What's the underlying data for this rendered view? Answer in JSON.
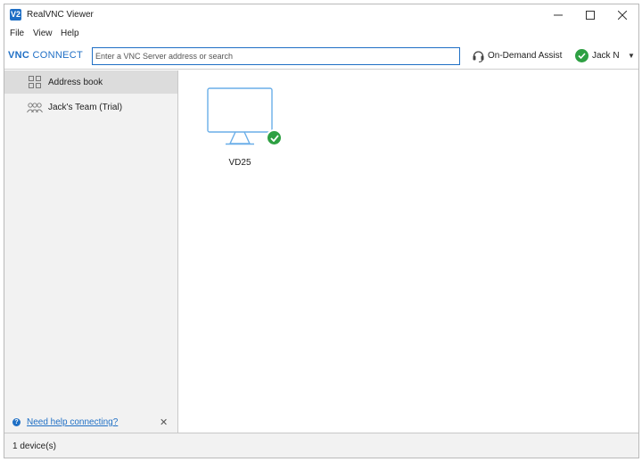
{
  "window": {
    "title": "RealVNC Viewer",
    "icon_glyph": "V2"
  },
  "menu": {
    "items": [
      "File",
      "View",
      "Help"
    ]
  },
  "toolbar": {
    "brand_prefix": "VNC",
    "brand_suffix": "CONNECT",
    "search_placeholder": "Enter a VNC Server address or search",
    "assist_label": "On-Demand Assist",
    "user_name": "Jack N",
    "user_caret": "▼"
  },
  "sidebar": {
    "items": [
      {
        "label": "Address book",
        "icon": "grid-icon",
        "active": true
      },
      {
        "label": "Jack's Team (Trial)",
        "icon": "team-icon",
        "active": false
      }
    ],
    "help_link": "Need help connecting?",
    "help_icon_glyph": "?",
    "help_close": "✕"
  },
  "devices": [
    {
      "name": "VD25",
      "status": "online"
    }
  ],
  "status": {
    "text": "1 device(s)"
  },
  "colors": {
    "accent": "#1f6fc5",
    "online": "#2ea043",
    "sidebar_bg": "#f2f2f2"
  }
}
